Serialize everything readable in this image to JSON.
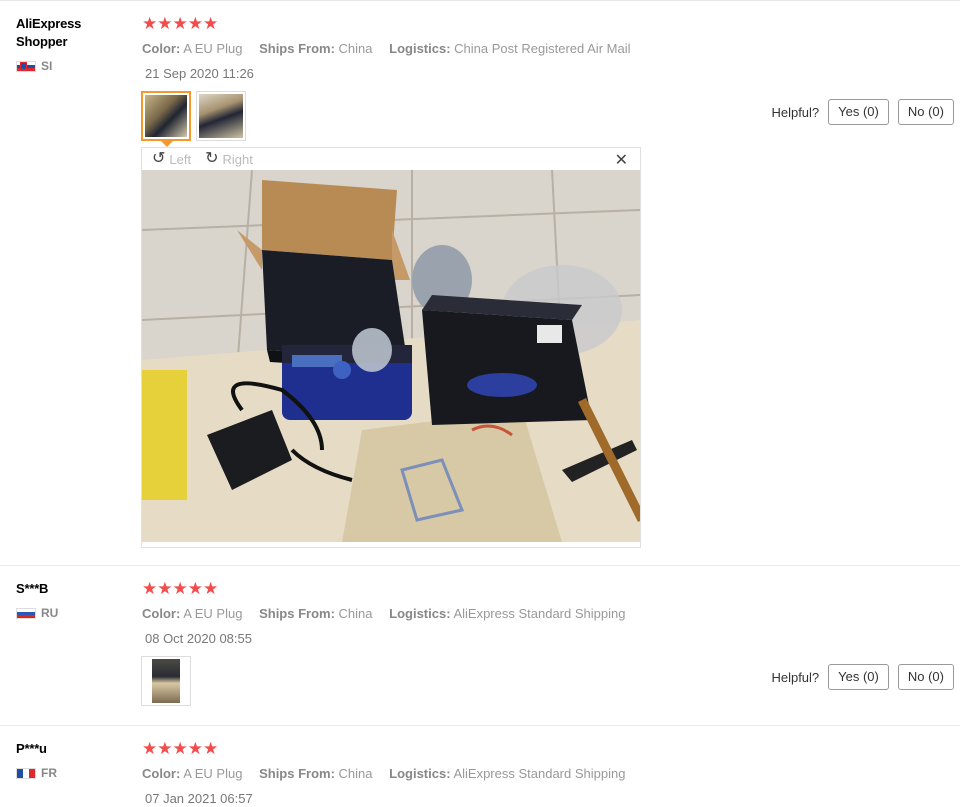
{
  "reviews": [
    {
      "user": "AliExpress Shopper",
      "country": "SI",
      "stars": "★★★★★",
      "meta": {
        "color_label": "Color:",
        "color_value": "A EU Plug",
        "ships_label": "Ships From:",
        "ships_value": "China",
        "logistics_label": "Logistics:",
        "logistics_value": "China Post Registered Air Mail"
      },
      "date": "21 Sep 2020 11:26",
      "helpful_label": "Helpful?",
      "yes": "Yes (0)",
      "no": "No (0)"
    },
    {
      "user": "S***B",
      "country": "RU",
      "stars": "★★★★★",
      "meta": {
        "color_label": "Color:",
        "color_value": "A EU Plug",
        "ships_label": "Ships From:",
        "ships_value": "China",
        "logistics_label": "Logistics:",
        "logistics_value": "AliExpress Standard Shipping"
      },
      "date": "08 Oct 2020 08:55",
      "helpful_label": "Helpful?",
      "yes": "Yes (0)",
      "no": "No (0)"
    },
    {
      "user": "P***u",
      "country": "FR",
      "stars": "★★★★★",
      "meta": {
        "color_label": "Color:",
        "color_value": "A EU Plug",
        "ships_label": "Ships From:",
        "ships_value": "China",
        "logistics_label": "Logistics:",
        "logistics_value": "AliExpress Standard Shipping"
      },
      "date": "07 Jan 2021 06:57"
    }
  ],
  "viewer": {
    "rotate_left": "Left",
    "rotate_right": "Right",
    "close": "✕"
  },
  "colors": {
    "star": "#f44c4c",
    "active_thumb": "#f59a2a"
  }
}
